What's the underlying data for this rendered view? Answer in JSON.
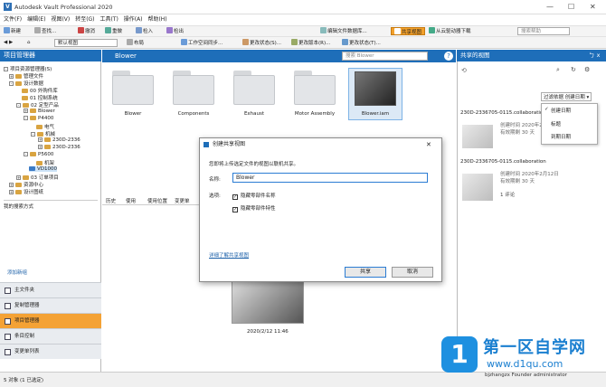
{
  "app": {
    "title": "Autodesk Vault Professional 2020",
    "win_min": "—",
    "win_max": "☐",
    "win_close": "✕",
    "icon_letter": "V"
  },
  "menu": [
    "文件(F)",
    "编辑(E)",
    "视图(V)",
    "转至(G)",
    "工具(T)",
    "操作(A)",
    "帮助(H)"
  ],
  "toolbar": {
    "new": "新建",
    "find": "查找...",
    "undo": "撤消",
    "redo": "重做",
    "check_in": "检入",
    "check_out": "检出",
    "edit_file_props": "编辑文件数据库...",
    "shared_view": "共享视图",
    "from_cloud": "从云驱动器下载",
    "search_placeholder": "搜索帮助",
    "view": "默认视图",
    "layout": "布局",
    "work_area": "工作空间同步...",
    "rev_change": "更改状态(S)...",
    "change_rev": "更改版本(R)...",
    "change_status": "更改状态(T)..."
  },
  "left": {
    "title": "项目管理器",
    "tree": [
      "项目资源管理器(S)",
      "管理文件",
      "设计数据",
      "00 外购件库",
      "01 控制系统",
      "02 定型产品",
      "Blower",
      "P4400",
      "电气",
      "机械",
      "230D-2336",
      "230D-2336",
      "P5600",
      "机架",
      "VD1000",
      "03 订单项目",
      "资源中心",
      "设计图纸",
      "我的搜索方式"
    ],
    "link": "添加新组",
    "nav": [
      "主文件夹",
      "复制管理器",
      "项目管理器",
      "条目控制",
      "变更单列表"
    ]
  },
  "main": {
    "folder": "Blower",
    "search_placeholder": "搜索 Blower",
    "items": [
      "Blower",
      "Components",
      "Exhaust",
      "Motor Assembly",
      "Blower.iam"
    ],
    "tabs": [
      "历史",
      "使用",
      "使用位置",
      "变更单"
    ],
    "preview_time": "2020/2/12 11:46"
  },
  "dialog": {
    "title": "创建共享视图",
    "desc": "您即将上传选定文件的视图以联机共享。",
    "name_label": "名称:",
    "name_value": "Blower",
    "options_label": "选项:",
    "opt1": "隐藏零部件名称",
    "opt2": "隐藏零部件特性",
    "link": "详细了解共享视图",
    "ok": "共享",
    "cancel": "取消",
    "close": "✕"
  },
  "right": {
    "title": "共享的视图",
    "pin": "ㄅ x",
    "filter": "过滤依据",
    "sort": "创建日期",
    "menu": [
      "创建日期",
      "标题",
      "到期日期"
    ],
    "cards": [
      {
        "title": "230D-2336705-0115.collaboration",
        "created": "创建时间 2020年2月12日",
        "expires": "有效期剩 30 天",
        "comments": "1 评论"
      },
      {
        "title": "230D-2336705-0115.collaboration",
        "created": "创建时间 2020年2月12日",
        "expires": "有效期剩 30 天",
        "comments": "1 评论"
      }
    ]
  },
  "status": {
    "count": "5 对象 (1 已选定)"
  },
  "watermark": {
    "icon": "1",
    "name": "第一区自学网",
    "url": "www.d1qu.com",
    "user": "bjzhangzx  Founder  administrator"
  }
}
